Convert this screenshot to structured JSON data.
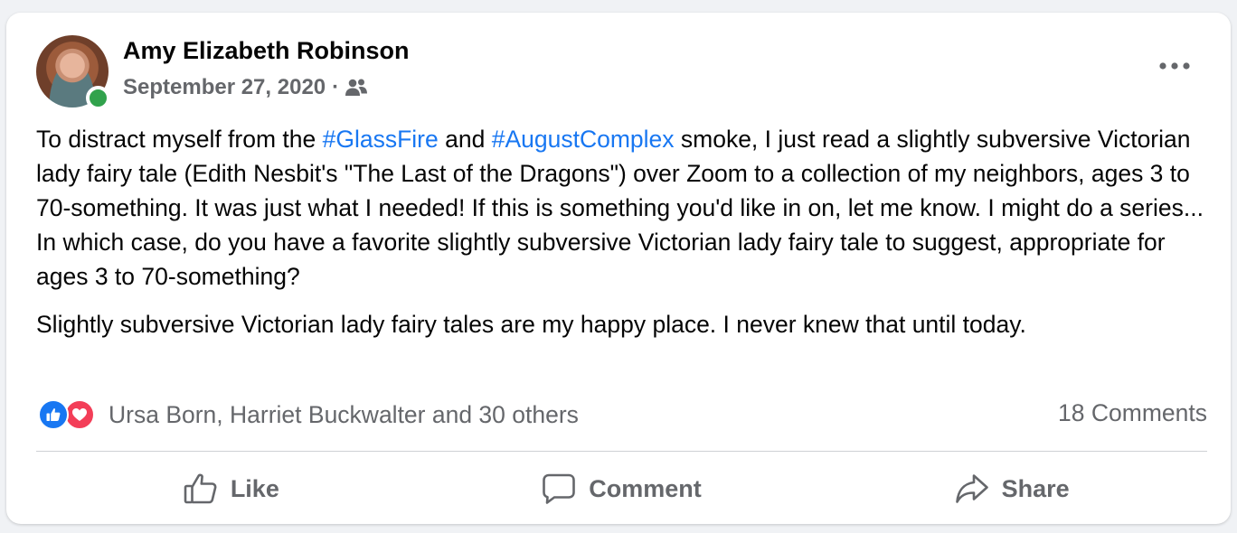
{
  "post": {
    "author": "Amy Elizabeth Robinson",
    "date": "September 27, 2020",
    "separator": "·",
    "audience_icon": "friends-icon",
    "more_icon": "more-options-icon",
    "paragraph1": {
      "part1": "To distract myself from the ",
      "hashtag1": "#GlassFire",
      "part2": " and ",
      "hashtag2": "#AugustComplex",
      "part3": " smoke, I just read a slightly subversive Victorian lady fairy tale (Edith Nesbit's \"The Last of the Dragons\") over Zoom to a collection of my neighbors, ages 3 to 70-something. It was just what I needed! If this is something you'd like in on, let me know. I might do a series... In which case, do you have a favorite slightly subversive Victorian lady fairy tale to suggest, appropriate for ages 3 to 70-something?"
    },
    "paragraph2": "Slightly subversive Victorian lady fairy tales are my happy place. I never knew that until today."
  },
  "reactions": {
    "icons": [
      "like-reaction-icon",
      "love-reaction-icon"
    ],
    "summary": "Ursa Born, Harriet Buckwalter and 30 others",
    "comments": "18 Comments"
  },
  "actions": {
    "like": "Like",
    "comment": "Comment",
    "share": "Share"
  },
  "colors": {
    "hashtag": "#1877f2",
    "like_blue": "#1877f2",
    "love_red": "#f33e58",
    "online_green": "#31a24c",
    "secondary_text": "#65676b"
  }
}
